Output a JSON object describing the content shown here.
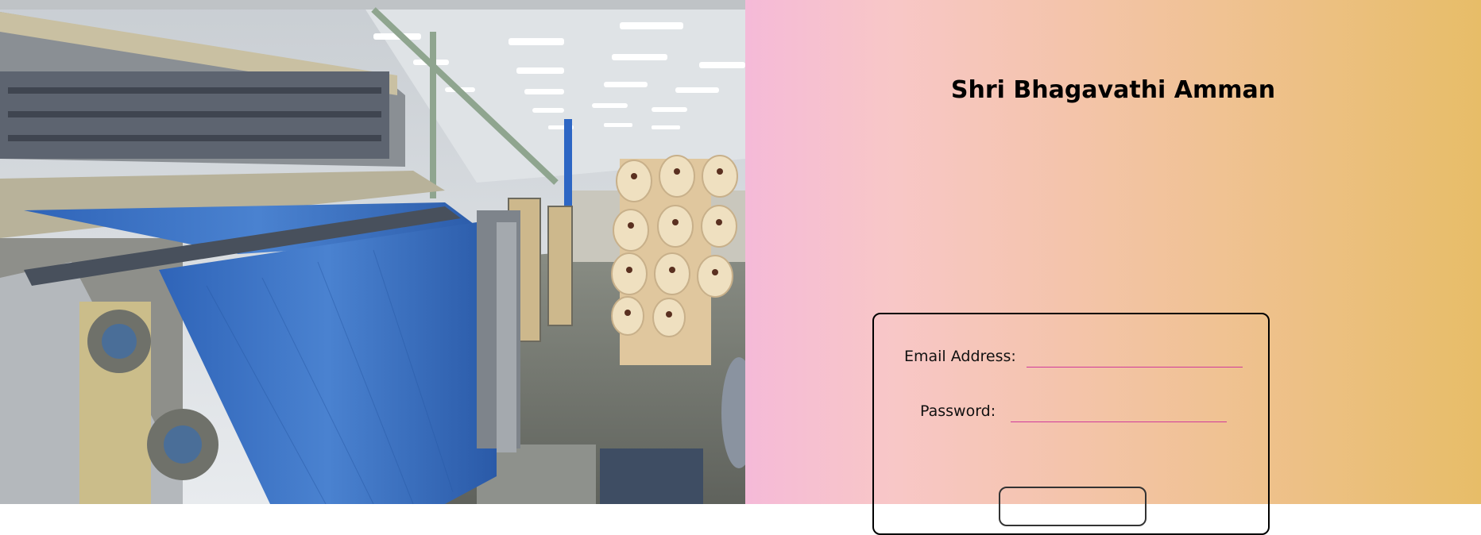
{
  "brand": {
    "title": "Shri Bhagavathi Amman"
  },
  "login_form": {
    "email_label": "Email Address:",
    "email_value": "",
    "password_label": "Password:",
    "password_value": "",
    "submit_label": ""
  },
  "hero_image": {
    "subject": "textile-loom-factory-photo"
  },
  "colors": {
    "gradient_start": "#f5bad8",
    "gradient_mid": "#f2c39e",
    "gradient_end": "#e7bd68",
    "input_underline": "#d03a9a",
    "fabric_blue": "#3a6fc0"
  }
}
